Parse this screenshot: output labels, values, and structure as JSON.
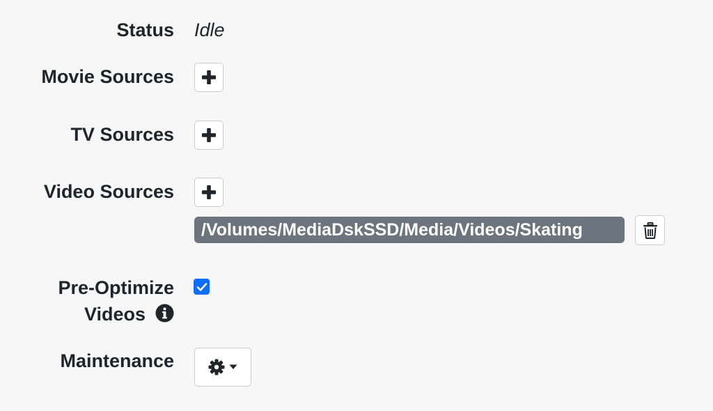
{
  "status": {
    "label": "Status",
    "value": "Idle"
  },
  "movie_sources": {
    "label": "Movie Sources"
  },
  "tv_sources": {
    "label": "TV Sources"
  },
  "video_sources": {
    "label": "Video Sources",
    "paths": [
      "/Volumes/MediaDskSSD/Media/Videos/Skating"
    ]
  },
  "pre_optimize": {
    "label_line1": "Pre-Optimize",
    "label_line2": "Videos",
    "checked": true
  },
  "maintenance": {
    "label": "Maintenance"
  },
  "icons": {
    "add": "plus-icon",
    "delete": "trash-icon",
    "info": "info-circle-icon",
    "settings": "gear-icon",
    "dropdown": "caret-down-icon",
    "check": "checkmark-icon"
  },
  "colors": {
    "badge_bg": "#6c757d",
    "checkbox_bg": "#0d6efd",
    "text": "#212529"
  }
}
